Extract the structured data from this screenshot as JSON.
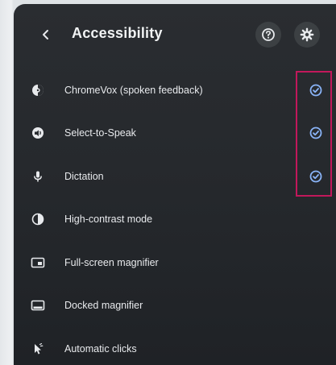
{
  "header": {
    "title": "Accessibility",
    "back_icon": "chevron-left-icon",
    "help_icon": "help-icon",
    "settings_icon": "gear-icon"
  },
  "items": [
    {
      "label": "ChromeVox (spoken feedback)",
      "icon": "chromevox-icon",
      "checked": true
    },
    {
      "label": "Select-to-Speak",
      "icon": "select-to-speak-icon",
      "checked": true
    },
    {
      "label": "Dictation",
      "icon": "microphone-icon",
      "checked": true
    },
    {
      "label": "High-contrast mode",
      "icon": "contrast-icon",
      "checked": false
    },
    {
      "label": "Full-screen magnifier",
      "icon": "fullscreen-magnifier-icon",
      "checked": false
    },
    {
      "label": "Docked magnifier",
      "icon": "docked-magnifier-icon",
      "checked": false
    },
    {
      "label": "Automatic clicks",
      "icon": "auto-click-icon",
      "checked": false
    }
  ],
  "colors": {
    "panel_bg": "#26292d",
    "check_accent": "#8ab4f8",
    "highlight_border": "#c2185b"
  }
}
